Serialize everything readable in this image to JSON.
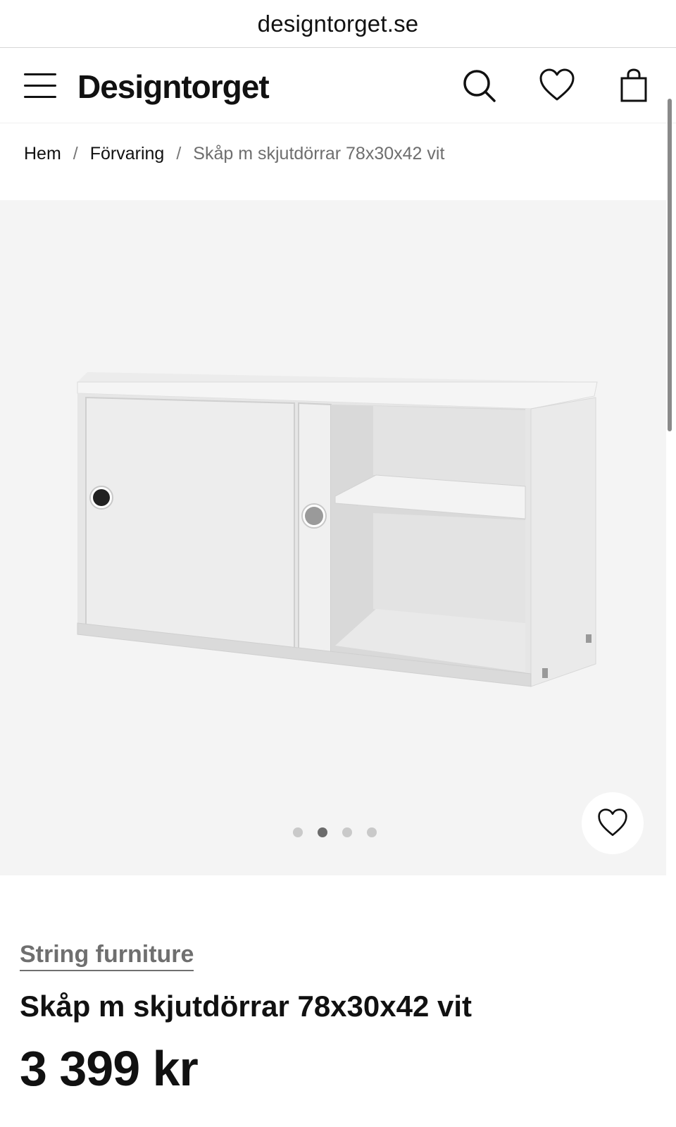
{
  "browser": {
    "url": "designtorget.se"
  },
  "header": {
    "logo": "Designtorget",
    "icons": [
      "menu-icon",
      "search-icon",
      "heart-icon",
      "shopping-bag-icon"
    ]
  },
  "breadcrumb": {
    "items": [
      "Hem",
      "Förvaring"
    ],
    "separator": "/",
    "current": "Skåp m skjutdörrar 78x30x42 vit"
  },
  "gallery": {
    "image_alt": "white-sliding-door-cabinet",
    "slide_count": 4,
    "active_slide": 2,
    "favorite_icon": "heart-icon"
  },
  "product": {
    "brand": "String furniture",
    "title": "Skåp m skjutdörrar 78x30x42 vit",
    "price": "3 399 kr"
  },
  "colors": {
    "gallery_bg": "#f4f4f4",
    "text": "#111111",
    "muted": "#6f6f6f",
    "dot_active": "#6b6b6b",
    "dot_inactive": "#c9c9c9"
  }
}
